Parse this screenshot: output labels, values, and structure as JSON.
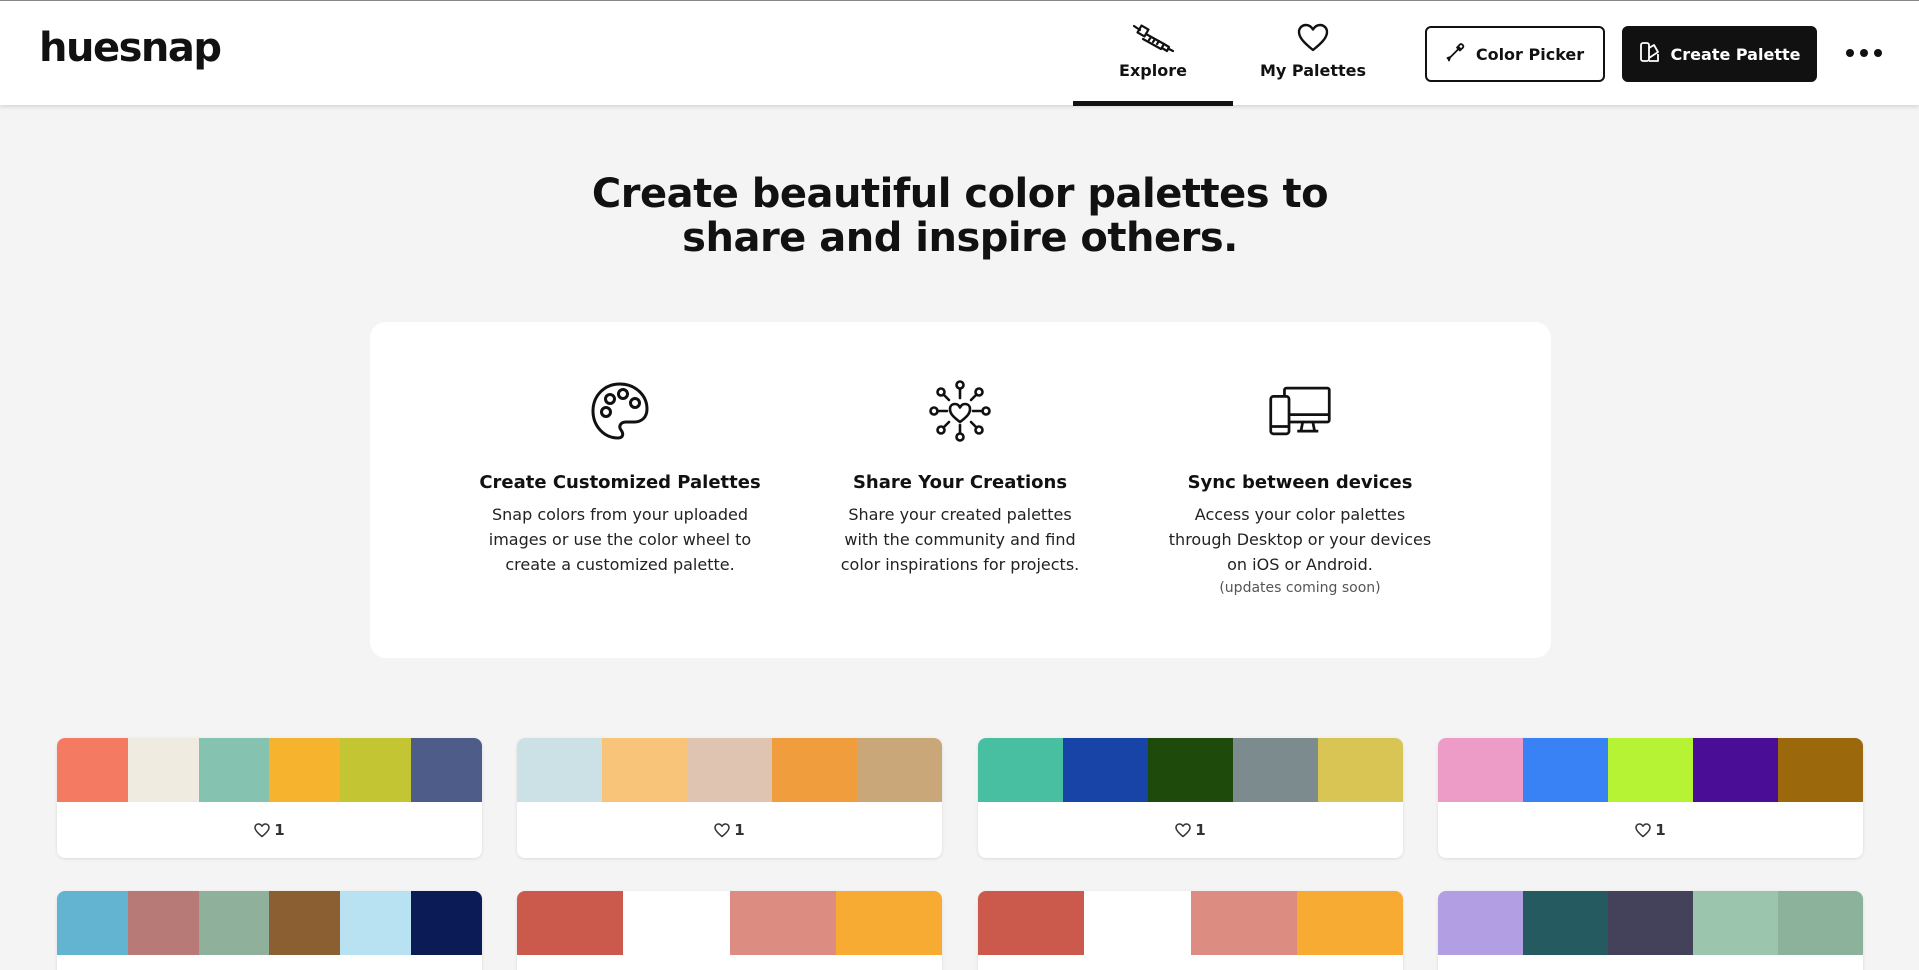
{
  "header": {
    "logo": "huesnap",
    "tabs": [
      {
        "label": "Explore",
        "icon": "eyedropper-icon",
        "active": true
      },
      {
        "label": "My Palettes",
        "icon": "heart-icon",
        "active": false
      }
    ],
    "color_picker_label": "Color Picker",
    "create_palette_label": "Create Palette"
  },
  "hero": {
    "line1": "Create beautiful color palettes to",
    "line2": "share and inspire others."
  },
  "features": [
    {
      "icon": "palette-icon",
      "title": "Create Customized Palettes",
      "lines": [
        "Snap colors from your uploaded",
        "images or use the color wheel to",
        "create a customized palette."
      ],
      "note": ""
    },
    {
      "icon": "network-heart-icon",
      "title": "Share Your Creations",
      "lines": [
        "Share your created palettes",
        "with the community and find",
        "color inspirations for projects."
      ],
      "note": ""
    },
    {
      "icon": "devices-icon",
      "title": "Sync between devices",
      "lines": [
        "Access your color palettes",
        "through Desktop or your devices",
        "on iOS or Android."
      ],
      "note": "(updates coming soon)"
    }
  ],
  "palettes": [
    {
      "colors": [
        "#f47a62",
        "#efebe1",
        "#86c2b0",
        "#f6b32d",
        "#c3c632",
        "#4d5c89"
      ],
      "likes": "1"
    },
    {
      "colors": [
        "#cce1e5",
        "#f8c479",
        "#dfc4b2",
        "#f09e3d",
        "#c9a779"
      ],
      "likes": "1"
    },
    {
      "colors": [
        "#49bfa2",
        "#1844a7",
        "#1e4b0b",
        "#7b8b8e",
        "#d8c553"
      ],
      "likes": "1"
    },
    {
      "colors": [
        "#ed9bc7",
        "#3982f5",
        "#b5f334",
        "#4a0e96",
        "#9b680b"
      ],
      "likes": "1"
    },
    {
      "colors": [
        "#62b4d0",
        "#b87a76",
        "#8fb09a",
        "#8b5f32",
        "#b8e2f1",
        "#0b1b56"
      ],
      "likes": ""
    },
    {
      "colors": [
        "#cb5a4c",
        "#ffffff",
        "#dc8c80",
        "#f7ab33"
      ],
      "likes": ""
    },
    {
      "colors": [
        "#cb5a4c",
        "#ffffff",
        "#dc8c80",
        "#f7ab33"
      ],
      "likes": ""
    },
    {
      "colors": [
        "#b29ee2",
        "#245a60",
        "#43425a",
        "#9bc5ad",
        "#8db29b"
      ],
      "likes": ""
    }
  ]
}
